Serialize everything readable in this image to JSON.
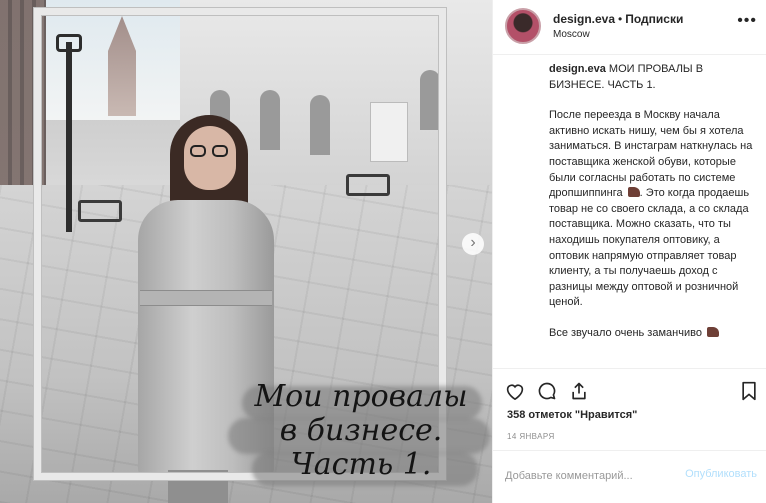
{
  "post": {
    "overlay_title_lines": [
      "Мои провалы",
      "в бизнесе.",
      "Часть 1."
    ]
  },
  "header": {
    "username": "design.eva",
    "separator": "•",
    "follow_label": "Подписки",
    "location": "Moscow",
    "more_icon": "more-horizontal-icon"
  },
  "caption": {
    "username": "design.eva",
    "title": "МОИ ПРОВАЛЫ В БИЗНЕСЕ. ЧАСТЬ 1.",
    "paragraph_1": "После переезда в Москву начала активно искать нишу, чем бы я хотела заниматься. В инстаграм наткнулась на поставщика женской обуви, которые были согласны работать по системе дропшиппинга",
    "paragraph_1_tail": ". Это когда продаешь товар не со своего склада, а со склада поставщика. Можно сказать, что ты находишь покупателя оптовику, а оптовик напрямую отправляет товар клиенту, а ты получаешь доход с разницы между оптовой и розничной ценой.",
    "paragraph_2": "Все звучало очень заманчиво"
  },
  "actions": {
    "like_icon": "heart-icon",
    "comment_icon": "comment-icon",
    "share_icon": "share-icon",
    "save_icon": "bookmark-icon",
    "likes_count": "358",
    "likes_text": "отметок \"Нравится\"",
    "date": "14 января"
  },
  "comment": {
    "placeholder": "Добавьте комментарий...",
    "publish_label": "Опубликовать"
  },
  "colors": {
    "publish_disabled": "#b2dffc",
    "divider": "#efefef",
    "muted": "#8e8e8e"
  }
}
